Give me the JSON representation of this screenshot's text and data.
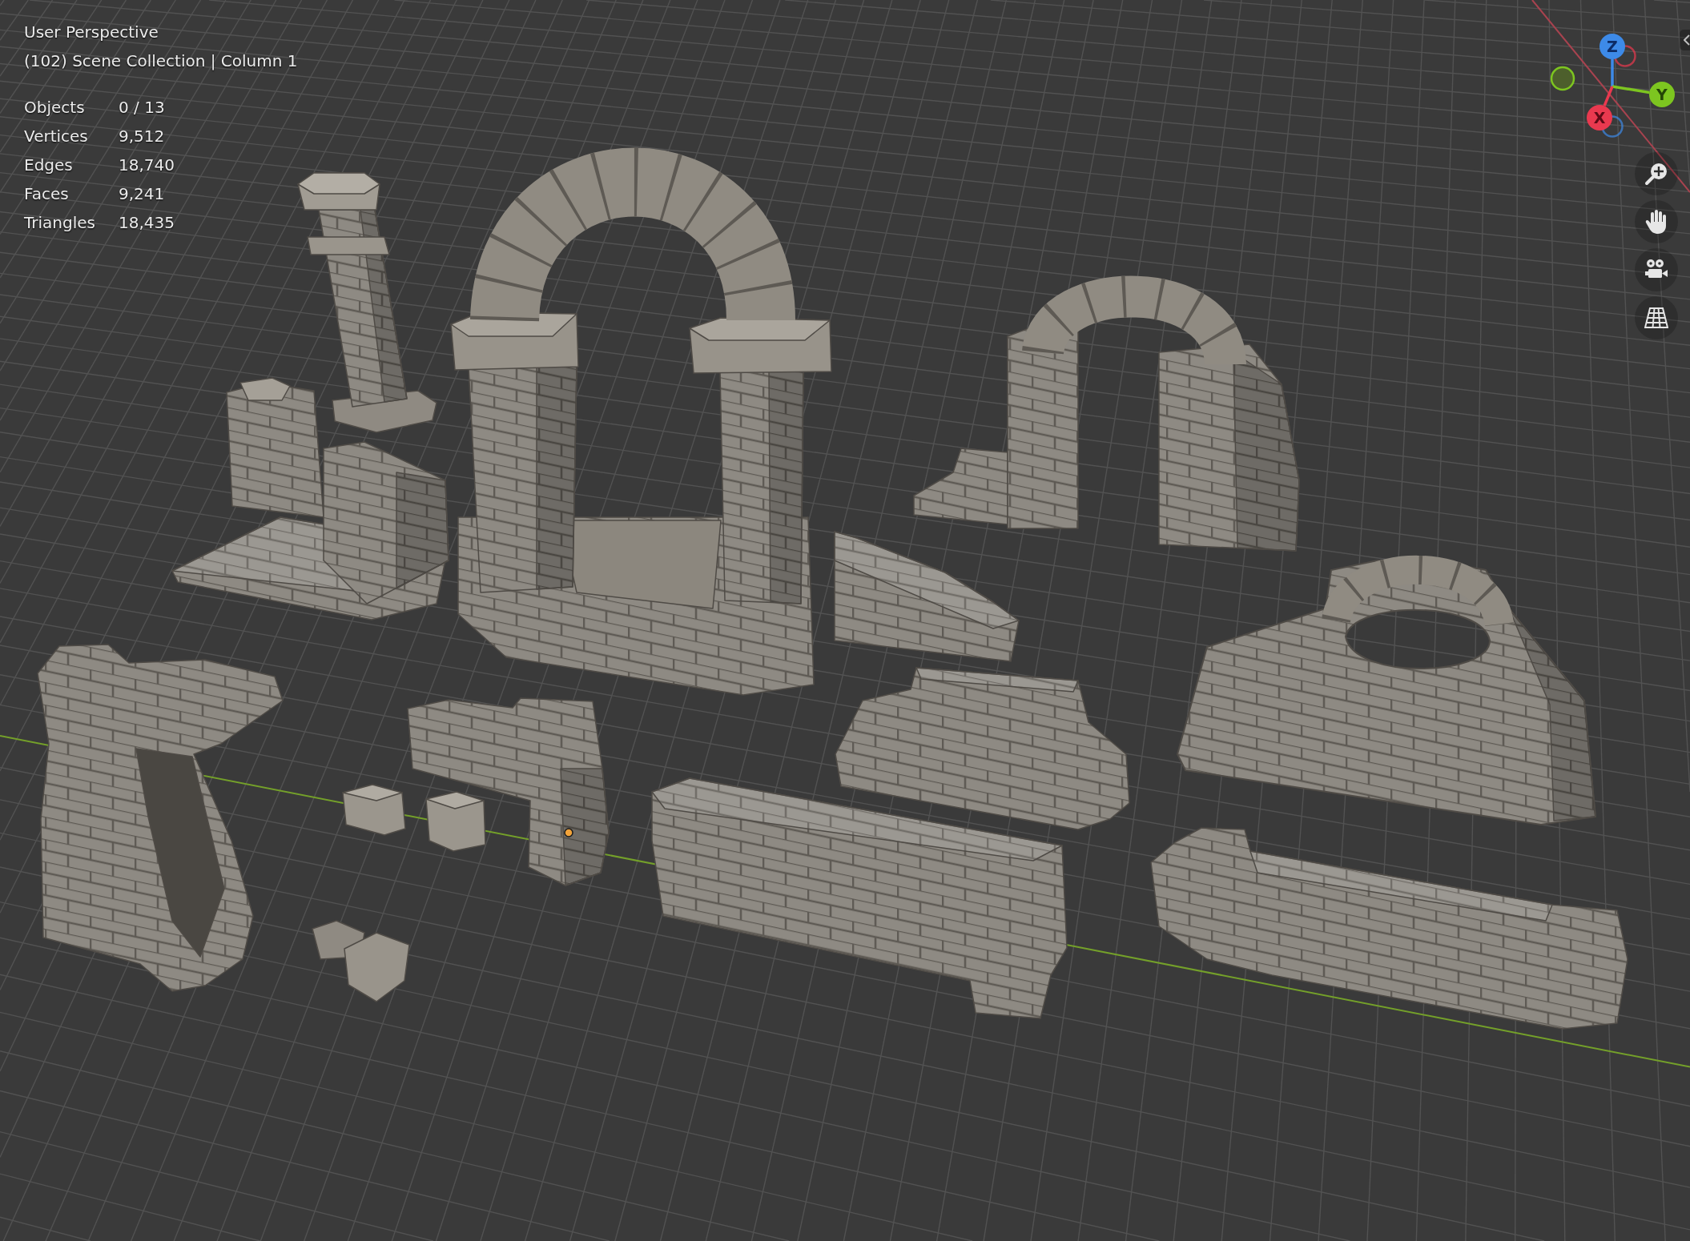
{
  "viewport": {
    "view_name": "User Perspective",
    "collection": "(102) Scene Collection | Column 1",
    "statistics": [
      {
        "label": "Objects",
        "value": "0 / 13"
      },
      {
        "label": "Vertices",
        "value": "9,512"
      },
      {
        "label": "Edges",
        "value": "18,740"
      },
      {
        "label": "Faces",
        "value": "9,241"
      },
      {
        "label": "Triangles",
        "value": "18,435"
      }
    ]
  },
  "navigation_gizmo": {
    "axes": [
      {
        "label": "Z",
        "color": "#3d8ae8"
      },
      {
        "label": "Y",
        "color": "#7dc520"
      },
      {
        "label": "X",
        "color": "#e9394f"
      }
    ]
  }
}
